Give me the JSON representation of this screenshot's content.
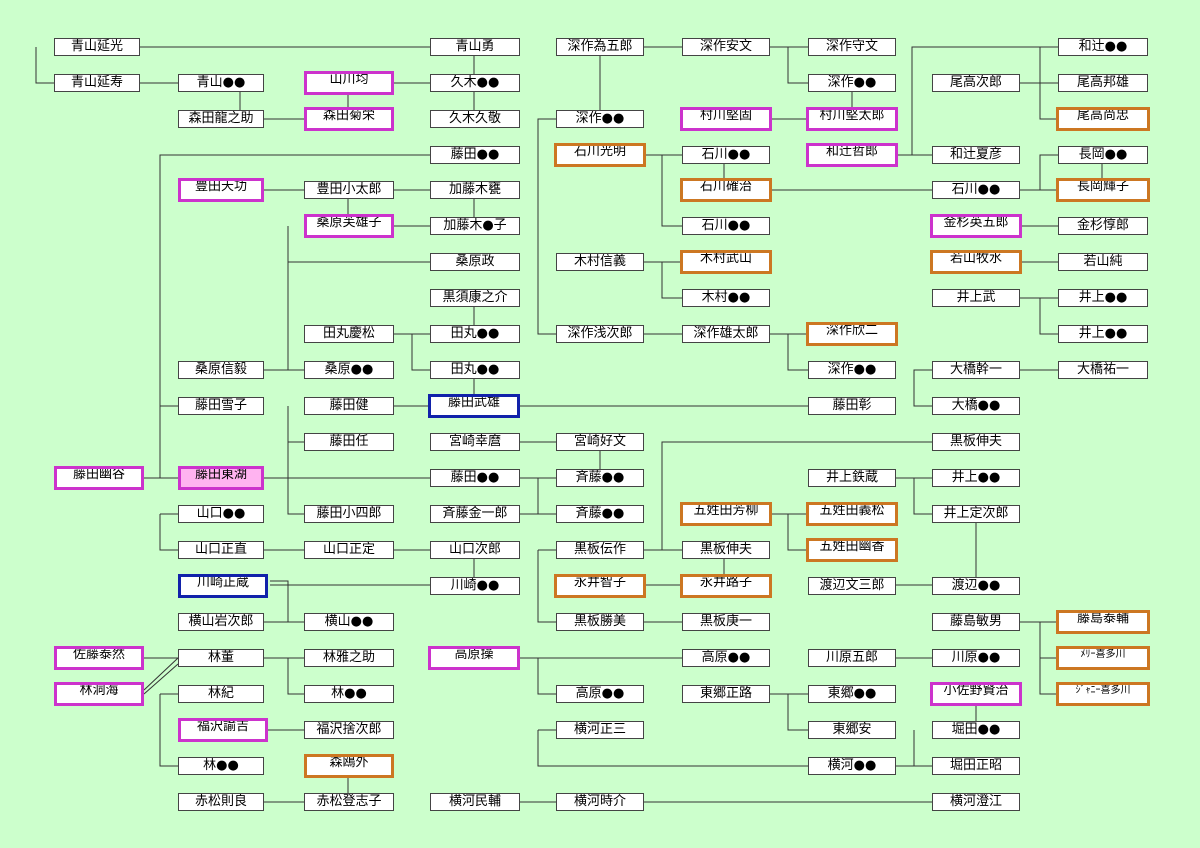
{
  "colors": {
    "background": "#ccffcc",
    "box_fill": "#ffffff",
    "purple_border": "#cc33cc",
    "orange_border": "#cc7722",
    "blue_border": "#1122aa",
    "pink_fill": "#ffb3f0",
    "line": "#333333"
  },
  "nodes": {
    "aoyama_nobumitsu": "青山延光",
    "aoyama_nobutoshi": "青山延寿",
    "aoyama_child": "青山●●",
    "morita_ryunosuke": "森田龍之助",
    "yamakawa_hitoshi": "山川均",
    "morita_kikue": "森田菊栄",
    "aoyama_isamu": "青山勇",
    "kuki_child1": "久木●●",
    "kuki_hisanori": "久木久敬",
    "fujita_child1": "藤田●●",
    "toyoda_tenko": "豊田天功",
    "toyoda_kotaro": "豊田小太郎",
    "kato_mokuhi": "加藤木甕",
    "kuwabara_fujiko": "桑原芙雄子",
    "kato_child": "加藤木●子",
    "kuwabara_tadashi": "桑原政",
    "kurosu_konosuke": "黒須康之介",
    "tamaru_keimatsu": "田丸慶松",
    "tamaru_child1": "田丸●●",
    "kuwabara_nobutake": "桑原信毅",
    "kuwabara_child": "桑原●●",
    "tamaru_child2": "田丸●●",
    "fujita_yukiko": "藤田雪子",
    "fujita_ken": "藤田健",
    "fujita_takeo": "藤田武雄",
    "fujita_nin": "藤田任",
    "miyazaki_koreki": "宮崎幸麿",
    "fujita_yukoku": "藤田幽谷",
    "fujita_toko": "藤田東湖",
    "fujita_child2": "藤田●●",
    "yamaguchi_child1": "山口●●",
    "fujita_koshiro": "藤田小四郎",
    "saito_kinichiro": "斉藤金一郎",
    "yamaguchi_masanao": "山口正直",
    "yamaguchi_masasada": "山口正定",
    "yamaguchi_jiro": "山口次郎",
    "kawasaki_masazo": "川崎正蔵",
    "kawasaki_child": "川崎●●",
    "yokoyama_iwajiro": "横山岩次郎",
    "yokoyama_child": "横山●●",
    "sato_taizen": "佐藤泰然",
    "hayashi_tadasu": "林董",
    "hayashi_masanosuke": "林雅之助",
    "hayashi_dokai": "林洞海",
    "hayashi_tadasu2": "林紀",
    "hayashi_child1": "林●●",
    "fukuzawa_yukichi": "福沢諭吉",
    "fukuzawa_sutejiro": "福沢捨次郎",
    "hayashi_child2": "林●●",
    "mori_ogai": "森鴎外",
    "akamatsu_noriyoshi": "赤松則良",
    "akamatsu_child": "赤松登志子",
    "fukasaku_tamegoro": "深作為五郎",
    "fukasaku_yasubumi": "深作安文",
    "fukasaku_morifumi": "深作守文",
    "fukasaku_child1": "深作●●",
    "fukasaku_child2": "深作●●",
    "murakawa_kengo": "村川堅固",
    "murakawa_kentaro": "村川堅太郎",
    "ishikawa_mitsuaki": "石川光明",
    "ishikawa_child1": "石川●●",
    "ishikawa_kakuji": "石川確治",
    "ishikawa_child2": "石川●●",
    "kimura_nobuyoshi": "木村信義",
    "kimura_buzan": "木村武山",
    "kimura_child": "木村●●",
    "fukasaku_asajiro": "深作浅次郎",
    "fukasaku_yutaro": "深作雄太郎",
    "fukasaku_kinji": "深作欣二",
    "fukasaku_child3": "深作●●",
    "fujita_akira": "藤田彰",
    "miyazaki_yoshifumi": "宮崎好文",
    "saito_child1": "斉藤●●",
    "saito_child2": "斉藤●●",
    "gosho_horyu": "五姓田芳柳",
    "gosho_yoshimatsu": "五姓田義松",
    "gosho_yuka": "五姓田幽香",
    "kuroita_densaku": "黒板伝作",
    "kuroita_nobuo_mid": "黒板伸夫",
    "nagai_tomoko": "永井智子",
    "nagai_michiko": "永井路子",
    "kuroita_katsumi": "黒板勝美",
    "kuroita_koichi": "黒板庚一",
    "takahara_misao": "高原操",
    "takahara_child1": "高原●●",
    "takahara_child2": "高原●●",
    "togo_masamichi": "東郷正路",
    "togo_child": "東郷●●",
    "togo_yasushi": "東郷安",
    "yokokawa_masazo": "横河正三",
    "yokokawa_child": "横河●●",
    "yokokawa_tamisuke": "横河民輔",
    "yokokawa_tokisuke": "横河時介",
    "wakatsuji_child": "和辻●●",
    "odaka_jiro": "尾高次郎",
    "odaka_kunio": "尾高邦雄",
    "odaka_hisatada": "尾高尚忠",
    "watsuji_tetsuro": "和辻哲郎",
    "watsuji_natsuhiko": "和辻夏彦",
    "nagaoka_child": "長岡●●",
    "ishikawa_child3": "石川●●",
    "nagaoka_teruko": "長岡輝子",
    "kanasugi_eigoro": "金杉英五郎",
    "kanasugi_jiro": "金杉惇郎",
    "wakayama_bokusui": "若山牧水",
    "wakayama_jun": "若山純",
    "inoue_takeshi": "井上武",
    "inoue_child1": "井上●●",
    "inoue_child2": "井上●●",
    "ohashi_kanichi": "大橋幹一",
    "ohashi_yuichi": "大橋祐一",
    "ohashi_child": "大橋●●",
    "kuroita_nobuo_right": "黒板伸夫",
    "inoue_tetsuzo": "井上鉄蔵",
    "inoue_child3": "井上●●",
    "inoue_sadajiro": "井上定次郎",
    "watanabe_bunzaburo": "渡辺文三郎",
    "watanabe_child": "渡辺●●",
    "fujishima_toshio": "藤島敏男",
    "fujishima_taisuke": "藤島泰輔",
    "kawahara_goro": "川原五郎",
    "kawahara_child": "川原●●",
    "mary_kitagawa": "ﾒﾘｰ喜多川",
    "koshino_kenji": "小佐野賢治",
    "johnny_kitagawa": "ｼﾞｬﾆｰ喜多川",
    "horita_child": "堀田●●",
    "horita_masaaki": "堀田正昭",
    "yokokawa_sumie": "横河澄江"
  }
}
